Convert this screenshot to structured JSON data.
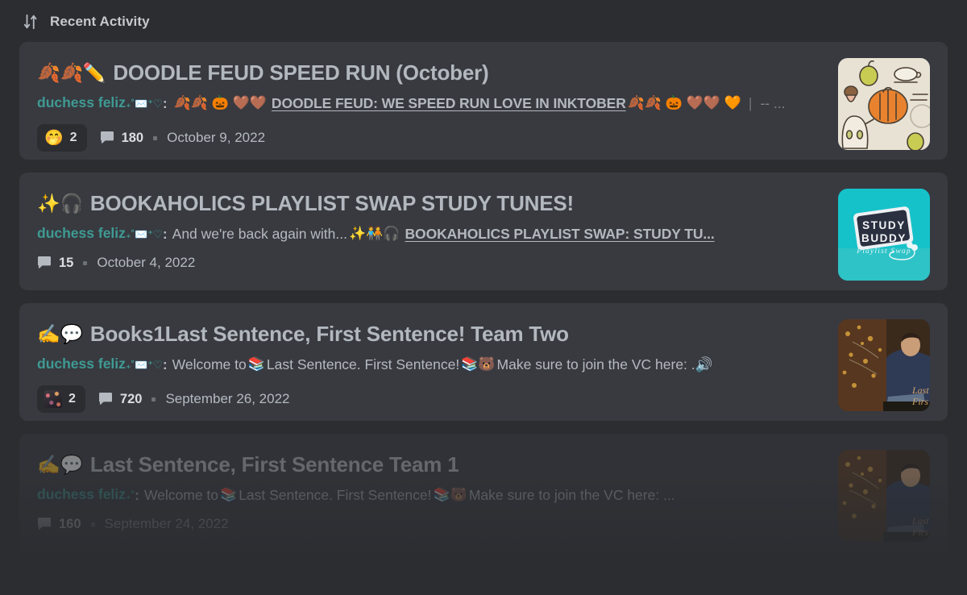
{
  "header": {
    "title": "Recent Activity",
    "sort_icon": "sort-arrows-icon"
  },
  "cards": [
    {
      "title_emoji": "🍂🍂✏️",
      "title": "DOODLE FEUD SPEED RUN (October)",
      "author": "duchess feliz",
      "author_decoration": "₊˚✉️⁺♡",
      "preview_text": "",
      "preview_emoji": "🍂🍂 🎃 🤎🤎",
      "preview_link": "DOODLE FEUD: WE SPEED RUN LOVE IN INKTOBER",
      "preview_trailing_emoji": "🍂🍂 🎃 🤎🤎 🧡",
      "preview_separator": "|",
      "preview_ellipsis": "-- ...",
      "reaction_emoji": "🤭",
      "reaction_count": "2",
      "reaction_type": "emoji",
      "comment_count": "180",
      "date": "October 9, 2022",
      "thumb": "autumn-doodles",
      "faded": false
    },
    {
      "title_emoji": "✨🎧",
      "title": "BOOKAHOLICS PLAYLIST SWAP STUDY TUNES!",
      "author": "duchess feliz",
      "author_decoration": "₊˚✉️⁺♡",
      "preview_text": "And we're back again with...",
      "preview_emoji": "✨🧑‍🤝‍🧑🎧",
      "preview_link": "BOOKAHOLICS PLAYLIST SWAP: STUDY TU...",
      "preview_trailing_emoji": "",
      "preview_separator": "",
      "preview_ellipsis": "",
      "reaction_emoji": "",
      "reaction_count": "",
      "reaction_type": "none",
      "comment_count": "15",
      "date": "October 4, 2022",
      "thumb": "study-buddy",
      "faded": false
    },
    {
      "title_emoji": "✍️💬",
      "title": "Books1Last Sentence, First Sentence! Team Two",
      "author": "duchess feliz",
      "author_decoration": "₊˚✉️⁺♡",
      "preview_text": "Welcome to",
      "preview_emoji": "📚",
      "preview_link": "",
      "preview_text2": "Last Sentence. First Sentence!",
      "preview_emoji2": "📚🐻",
      "preview_text3": "Make sure to join the VC here: .🔊",
      "preview_trailing_emoji": "",
      "preview_separator": "",
      "preview_ellipsis": "",
      "reaction_emoji": "",
      "reaction_count": "2",
      "reaction_type": "image",
      "comment_count": "720",
      "date": "September 26, 2022",
      "thumb": "reading-lights",
      "faded": false
    },
    {
      "title_emoji": "✍️💬",
      "title": "Last Sentence, First Sentence Team 1",
      "author": "duchess feliz",
      "author_decoration": "₊˚",
      "preview_text": "Welcome to",
      "preview_emoji": "📚",
      "preview_link": "",
      "preview_text2": "Last Sentence. First Sentence!",
      "preview_emoji2": "📚🐻",
      "preview_text3": "Make sure to join the VC here: ...",
      "preview_trailing_emoji": "",
      "preview_separator": "",
      "preview_ellipsis": "",
      "reaction_emoji": "",
      "reaction_count": "",
      "reaction_type": "none",
      "comment_count": "160",
      "date": "September 24, 2022",
      "thumb": "reading-lights",
      "faded": true
    }
  ],
  "colors": {
    "page_background": "#2b2d31",
    "card_background": "#383a40",
    "title_text": "#b3b8bf",
    "author_text": "#3f9a93",
    "meta_text": "#b5bac1",
    "pill_background": "#2b2d31"
  }
}
